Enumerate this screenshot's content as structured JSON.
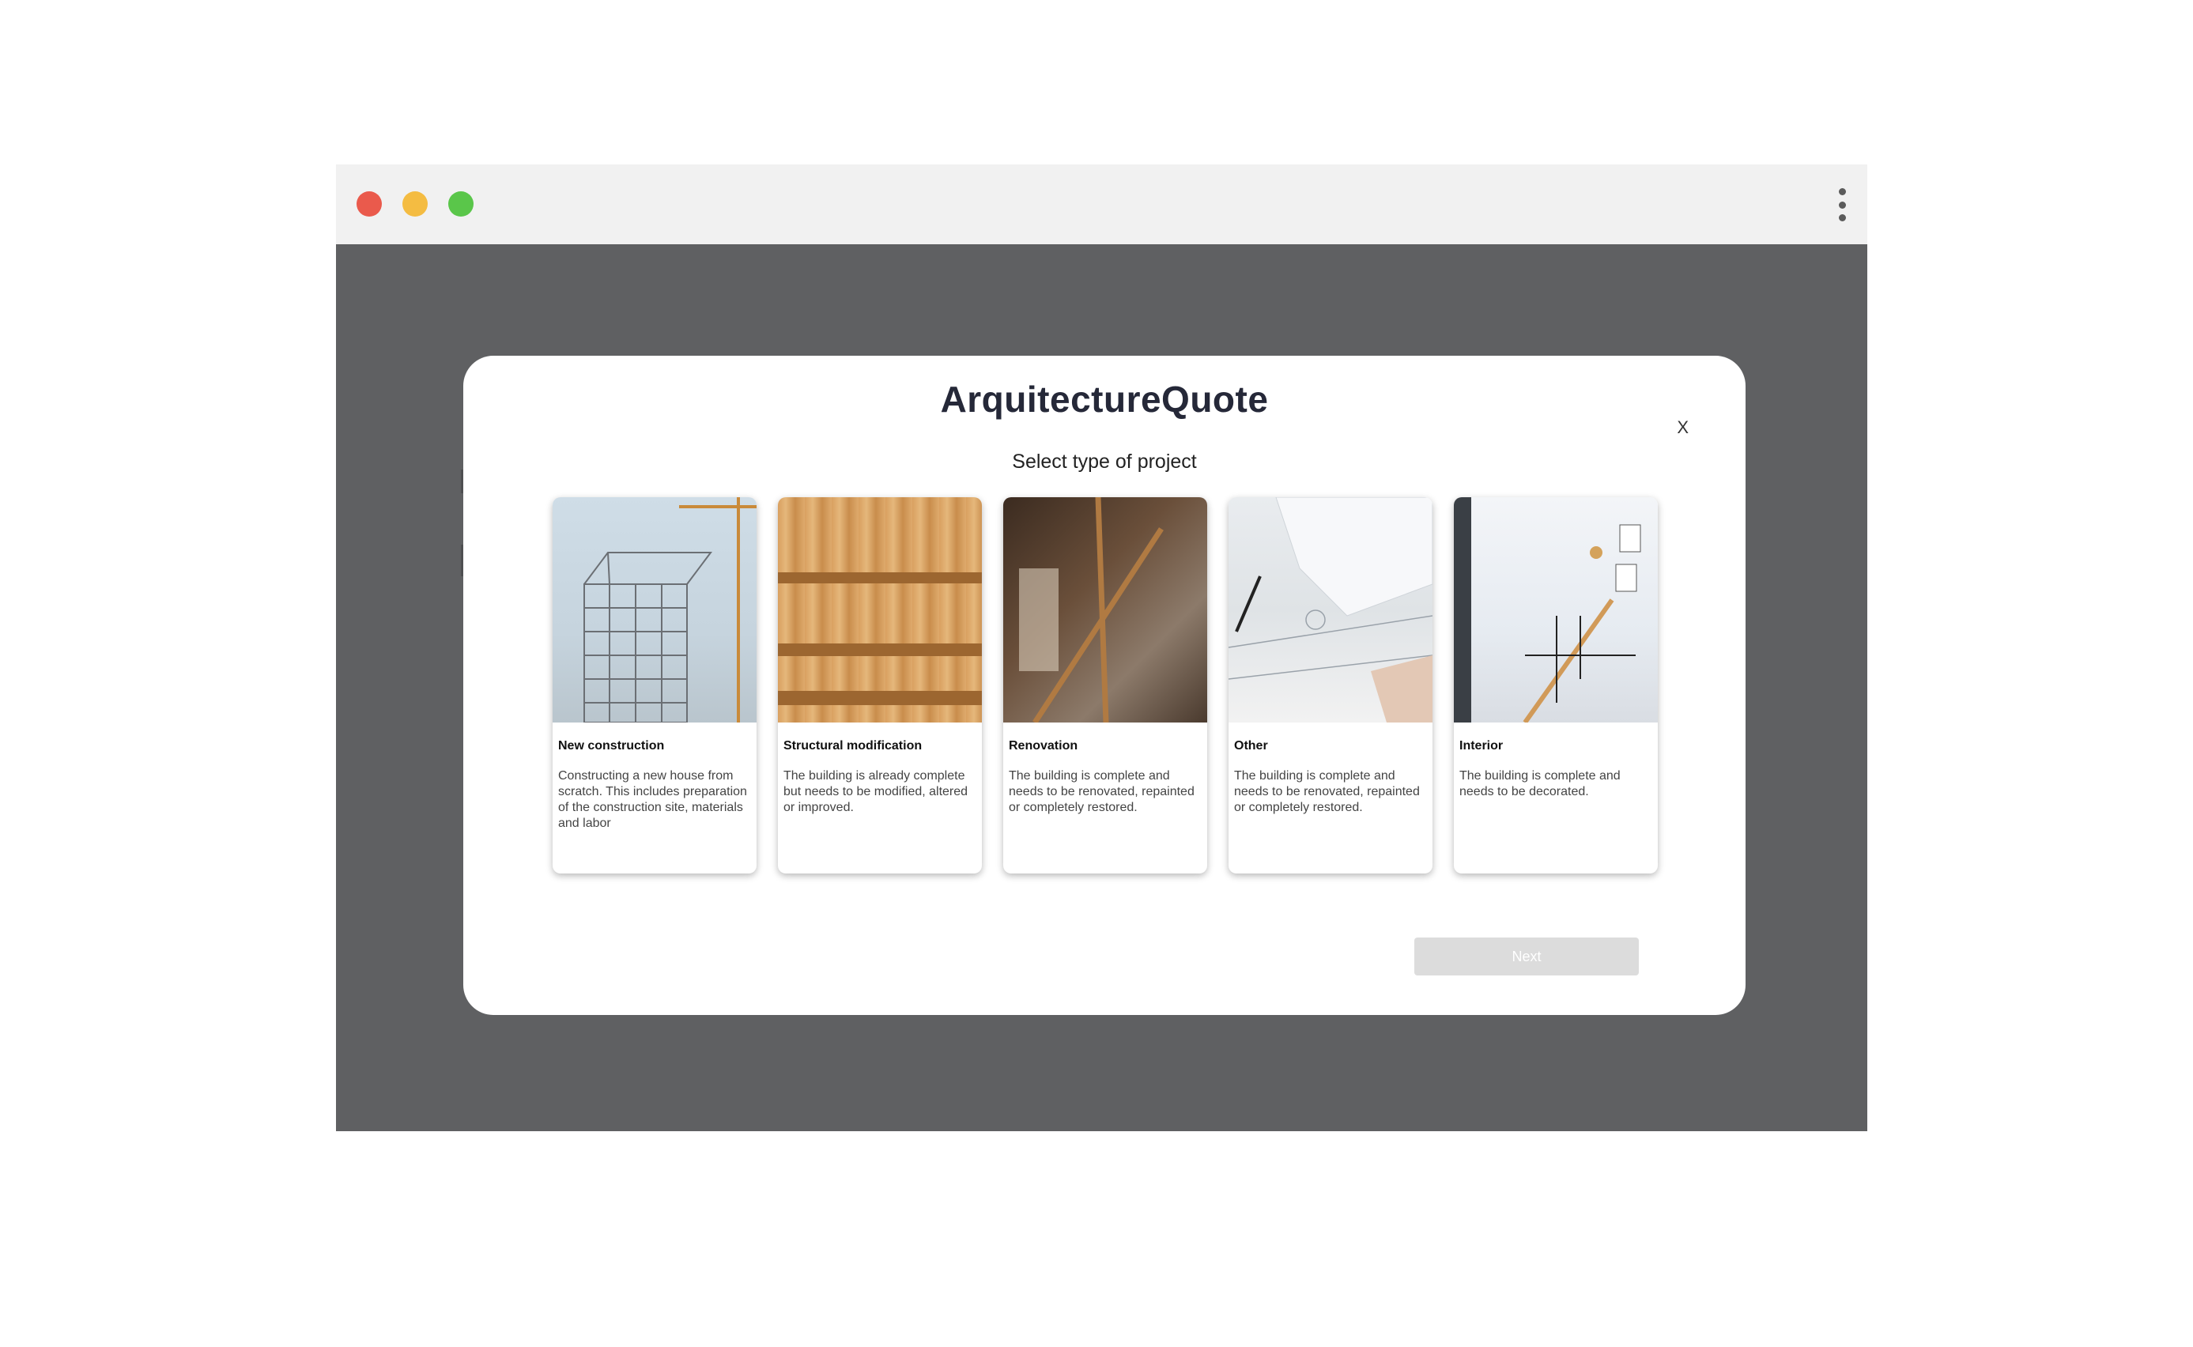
{
  "window": {
    "controls": {
      "close_color": "#ea5a4c",
      "minimize_color": "#f4bc42",
      "maximize_color": "#5ac64a",
      "menu_icon": "kebab-menu-icon"
    }
  },
  "modal": {
    "title": "ArquitectureQuote",
    "close_label": "X",
    "subtitle": "Select type of project",
    "cards": [
      {
        "title": "New construction",
        "description": "Constructing a new house from scratch. This includes preparation of the construction site, materials and labor",
        "image": "building-frame-with-cranes"
      },
      {
        "title": "Structural modification",
        "description": "The building is already complete but needs to be modified, altered or improved.",
        "image": "wooden-roof-beams"
      },
      {
        "title": "Renovation",
        "description": "The building is complete and needs to be renovated, repainted or completely restored.",
        "image": "worker-renovating-interior"
      },
      {
        "title": "Other",
        "description": "The building is complete and needs to be renovated, repainted or completely restored.",
        "image": "architect-drawing-plans"
      },
      {
        "title": "Interior",
        "description": "The building is complete and needs to be decorated.",
        "image": "interior-staircase"
      }
    ],
    "next_label": "Next"
  },
  "colors": {
    "overlay": "#5f6062",
    "title_text": "#252838",
    "next_button_bg": "#dcdcdc"
  }
}
